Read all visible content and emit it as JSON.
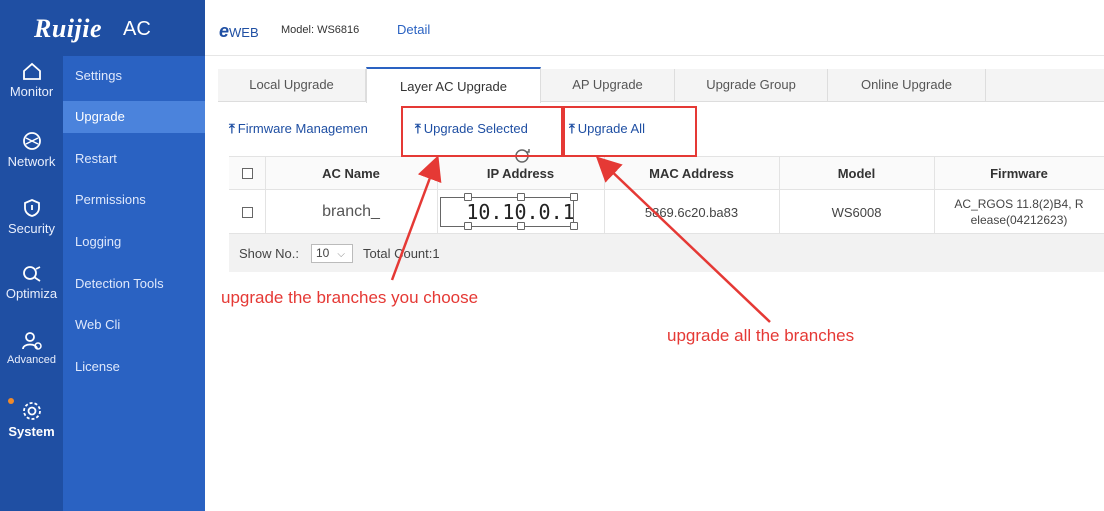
{
  "logo": {
    "brand": "Ruijie",
    "product": "AC"
  },
  "rail": [
    {
      "label": "Monitor",
      "icon": "home-icon"
    },
    {
      "label": "Network",
      "icon": "network-icon"
    },
    {
      "label": "Security",
      "icon": "shield-icon"
    },
    {
      "label": "Optimiza",
      "icon": "optimize-icon"
    },
    {
      "label": "Advanced",
      "icon": "users-icon"
    },
    {
      "label": "System",
      "icon": "gear-icon"
    }
  ],
  "submenu": [
    "Settings",
    "Upgrade",
    "Restart",
    "Permissions",
    "Logging",
    "Detection Tools",
    "Web Cli",
    "License"
  ],
  "header": {
    "ew": "WEB",
    "model": "Model: WS6816",
    "detail": "Detail"
  },
  "tabs": [
    "Local Upgrade",
    "Layer AC Upgrade",
    "AP Upgrade",
    "Upgrade Group",
    "Online Upgrade"
  ],
  "toolbar": {
    "firmware": "Firmware Managemen",
    "upgrade_selected": "Upgrade Selected",
    "upgrade_all": "Upgrade All"
  },
  "table": {
    "headers": [
      "AC Name",
      "IP Address",
      "MAC Address",
      "Model",
      "Firmware"
    ],
    "rows": [
      {
        "ac_name": "branch_",
        "ip": "10.10.0.1",
        "mac": "5869.6c20.ba83",
        "model": "WS6008",
        "firmware_1": "AC_RGOS 11.8(2)B4, R",
        "firmware_2": "elease(04212623)"
      }
    ]
  },
  "pager": {
    "show_label": "Show No.:",
    "page_size": "10",
    "total": "Total Count:1"
  },
  "annotations": {
    "left": "upgrade the branches you choose",
    "right": "upgrade all the branches"
  },
  "colors": {
    "rail": "#1f4fa3",
    "submenu": "#2a62c2",
    "active": "#4b83dc",
    "annotation": "#e53935"
  }
}
